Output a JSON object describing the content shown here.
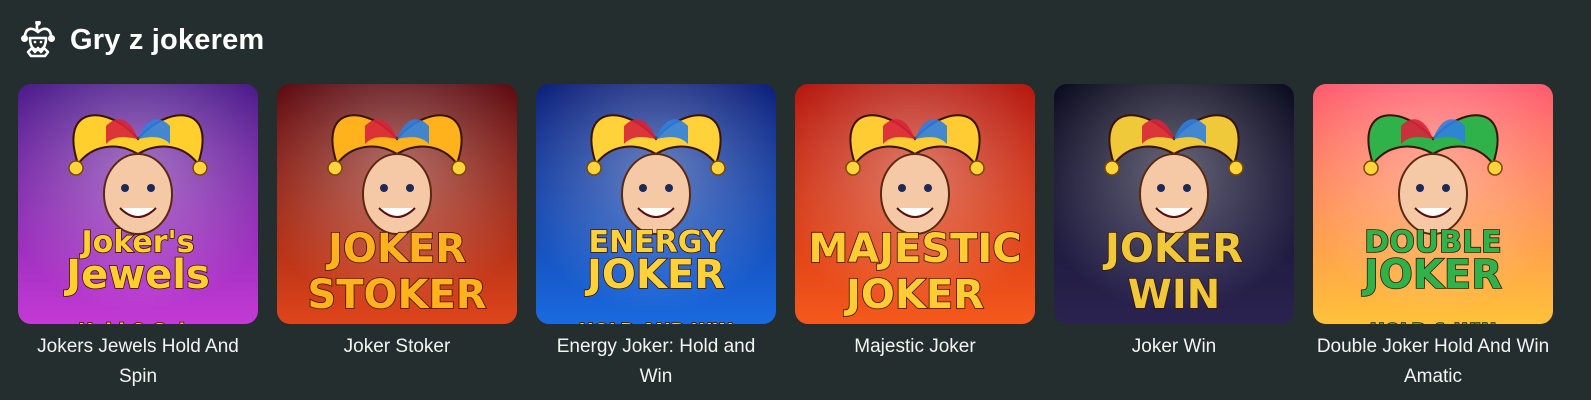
{
  "section": {
    "title": "Gry z jokerem",
    "icon": "jester-icon"
  },
  "games": [
    {
      "name": "Jokers Jewels Hold And Spin",
      "logo_lines": [
        "Joker's",
        "Jewels",
        "Hold & Spin"
      ],
      "colors": {
        "bg_top": "#4a1a8a",
        "bg_bottom": "#c43ad6",
        "accent": "#ffcf2e"
      }
    },
    {
      "name": "Joker Stoker",
      "logo_lines": [
        "JOKER",
        "STOKER"
      ],
      "colors": {
        "bg_top": "#5c0a10",
        "bg_bottom": "#e0451b",
        "accent": "#ffb21c"
      }
    },
    {
      "name": "Energy Joker: Hold and Win",
      "logo_lines": [
        "ENERGY",
        "JOKER",
        "HOLD AND WIN"
      ],
      "colors": {
        "bg_top": "#0c1f7a",
        "bg_bottom": "#1a6ae0",
        "accent": "#ffd23a"
      }
    },
    {
      "name": "Majestic Joker",
      "logo_lines": [
        "MAJESTIC",
        "JOKER"
      ],
      "colors": {
        "bg_top": "#b5160d",
        "bg_bottom": "#f5591c",
        "accent": "#ffcc33"
      }
    },
    {
      "name": "Joker Win",
      "logo_lines": [
        "JOKER",
        "WIN"
      ],
      "colors": {
        "bg_top": "#0a0a1e",
        "bg_bottom": "#2a2350",
        "accent": "#f0c93a"
      }
    },
    {
      "name": "Double Joker Hold And Win Amatic",
      "logo_lines": [
        "DOUBLE",
        "JOKER",
        "HOLD & WIN"
      ],
      "colors": {
        "bg_top": "#ff5a6e",
        "bg_bottom": "#ffc23a",
        "accent": "#2fb24a"
      }
    }
  ]
}
